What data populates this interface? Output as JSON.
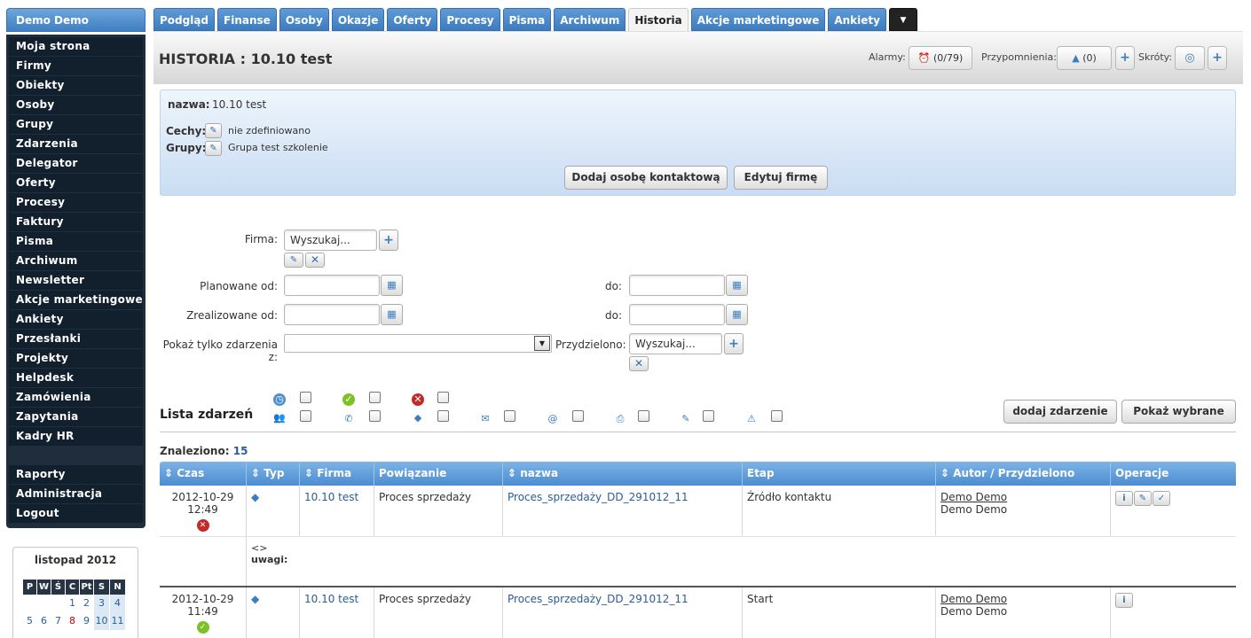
{
  "sidebar": {
    "user": "Demo Demo",
    "items": [
      "Moja strona",
      "Firmy",
      "Obiekty",
      "Osoby",
      "Grupy",
      "Zdarzenia",
      "Delegator",
      "Oferty",
      "Procesy",
      "Faktury",
      "Pisma",
      "Archiwum",
      "Newsletter",
      "Akcje marketingowe",
      "Ankiety",
      "Przesłanki",
      "Projekty",
      "Helpdesk",
      "Zamówienia",
      "Zapytania",
      "Kadry HR"
    ],
    "bottom_items": [
      "Raporty",
      "Administracja",
      "Logout"
    ]
  },
  "calendar": {
    "title": "listopad 2012",
    "days": [
      "P",
      "W",
      "Ś",
      "C",
      "Pt",
      "S",
      "N"
    ],
    "row1": [
      "",
      "",
      "",
      "1",
      "2",
      "3",
      "4"
    ],
    "row2": [
      "5",
      "6",
      "7",
      "8",
      "9",
      "10",
      "11"
    ]
  },
  "tabs": [
    "Podgląd",
    "Finanse",
    "Osoby",
    "Okazje",
    "Oferty",
    "Procesy",
    "Pisma",
    "Archiwum",
    "Historia",
    "Akcje marketingowe",
    "Ankiety",
    "▼"
  ],
  "header": {
    "title": "HISTORIA : 10.10 test",
    "alarmy_label": "Alarmy:",
    "alarmy_value": "(0/79)",
    "przypomnienia_label": "Przypomnienia:",
    "przypomnienia_value": "(0)",
    "skroty_label": "Skróty:",
    "plus": "+"
  },
  "info": {
    "nazwa_label": "nazwa:",
    "nazwa_value": "10.10 test",
    "cechy_label": "Cechy:",
    "cechy_value": "nie zdefiniowano",
    "grupy_label": "Grupy:",
    "grupy_value": "Grupa test szkolenie",
    "add_contact": "Dodaj osobę kontaktową",
    "edit_company": "Edytuj firmę"
  },
  "filters": {
    "firma_label": "Firma:",
    "search_placeholder": "Wyszukaj...",
    "planowane_label": "Planowane od:",
    "zrealizowane_label": "Zrealizowane od:",
    "do_label": "do:",
    "pokaz_label": "Pokaż tylko zdarzenia z:",
    "przydzielono_label": "Przydzielono:",
    "plus": "+",
    "close": "✕"
  },
  "list": {
    "title": "Lista zdarzeń",
    "add_event": "dodaj zdarzenie",
    "show_selected": "Pokaż wybrane",
    "found_label": "Znaleziono:",
    "found_count": "15"
  },
  "table": {
    "headers": [
      "Czas",
      "Typ",
      "Firma",
      "Powiązanie",
      "nazwa",
      "Etap",
      "Autor / Przydzielono",
      "Operacje"
    ],
    "rows": [
      {
        "date": "2012-10-29",
        "time": "12:49",
        "firma": "10.10 test",
        "powiazanie": "Proces sprzedaży",
        "nazwa": "Proces_sprzedaży_DD_291012_11",
        "etap": "Źródło kontaktu",
        "autor": "Demo Demo",
        "przydzielono": "Demo Demo",
        "note": "<>",
        "uwagi": "uwagi:"
      },
      {
        "date": "2012-10-29",
        "time": "11:49",
        "firma": "10.10 test",
        "powiazanie": "Proces sprzedaży",
        "nazwa": "Proces_sprzedaży_DD_291012_11",
        "etap": "Start",
        "autor": "Demo Demo",
        "przydzielono": "Demo Demo"
      }
    ]
  },
  "colors": {
    "accent": "#3c7cc0",
    "sidebar": "#1f2d3d",
    "info_bg": "#d9e7f6"
  }
}
